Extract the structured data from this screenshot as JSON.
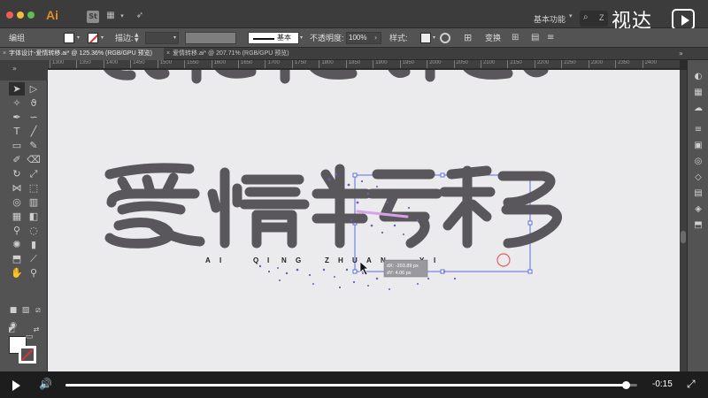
{
  "app": {
    "logo": "Ai",
    "workspace": "基本功能",
    "search_label": "Z",
    "watermark": "视达"
  },
  "control_bar": {
    "group_label": "编组",
    "stroke_label": "描边:",
    "profile_label": "基本",
    "opacity_label": "不透明度:",
    "opacity_value": "100%",
    "style_label": "样式:",
    "transform_label": "变换"
  },
  "tabs": [
    {
      "label": "字体设计-爱情转移.ai* @ 125.36% (RGB/GPU 预览)",
      "active": true
    },
    {
      "label": "爱情转移.ai* @ 207.71% (RGB/GPU 预览)",
      "active": false
    }
  ],
  "ruler": {
    "ticks": [
      "1300",
      "1350",
      "1400",
      "1450",
      "1500",
      "1550",
      "1600",
      "1650",
      "1700",
      "1750",
      "1800",
      "1850",
      "1900",
      "1950",
      "2000",
      "2050",
      "2100",
      "2150",
      "2200",
      "2250",
      "2300",
      "2350",
      "2400"
    ]
  },
  "artwork": {
    "title_chars": [
      "爱",
      "情",
      "转",
      "移"
    ],
    "pinyin": [
      "A",
      "I",
      "Q",
      "I",
      "N",
      "G",
      "Z",
      "H",
      "U",
      "A",
      "N",
      "Y",
      "I"
    ],
    "glyph_color": "#5a575c"
  },
  "tooltip": {
    "dx": "dX: -203.89 px",
    "dy": "dY: 4.06 px"
  },
  "colors": {
    "selection_blue": "#5b6ee0",
    "accent_magenta": "#d8a3e6",
    "cursor_ring": "#e3625f"
  },
  "video": {
    "time_remaining": "-0:15",
    "progress": 0.98
  }
}
